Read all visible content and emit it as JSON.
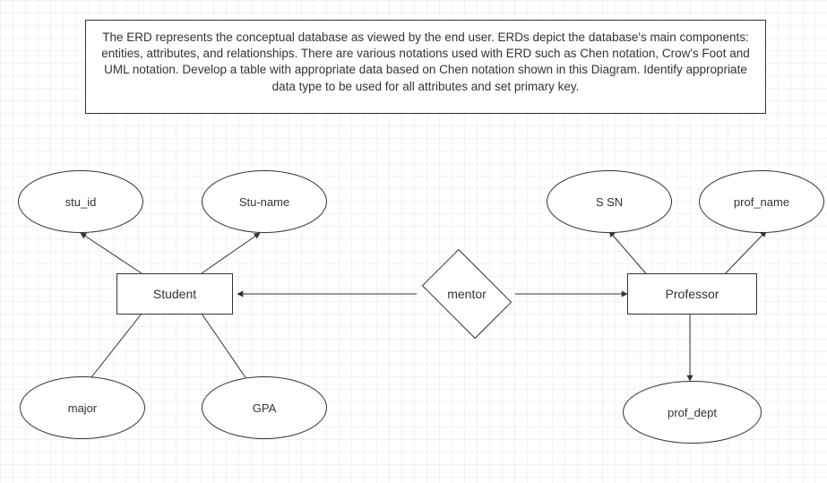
{
  "description": "The ERD represents the conceptual database as viewed by the end user. ERDs depict the database's main components: entities, attributes, and relationships. There are various notations used with ERD such as Chen notation, Crow's Foot and UML notation. Develop a table with appropriate data based on Chen notation shown in this Diagram. Identify appropriate data type to be used for all attributes and set primary key.",
  "entities": {
    "student": "Student",
    "professor": "Professor"
  },
  "relationship": {
    "mentor": "mentor"
  },
  "attributes": {
    "stu_id": "stu_id",
    "stu_name": "Stu-name",
    "major": "major",
    "gpa": "GPA",
    "ssn": "S SN",
    "prof_name": "prof_name",
    "prof_dept": "prof_dept"
  },
  "chart_data": {
    "type": "er-diagram-chen",
    "entities": [
      {
        "name": "Student",
        "attributes": [
          "stu_id",
          "Stu-name",
          "major",
          "GPA"
        ]
      },
      {
        "name": "Professor",
        "attributes": [
          "S SN",
          "prof_name",
          "prof_dept"
        ]
      }
    ],
    "relationships": [
      {
        "name": "mentor",
        "between": [
          "Student",
          "Professor"
        ]
      }
    ]
  }
}
